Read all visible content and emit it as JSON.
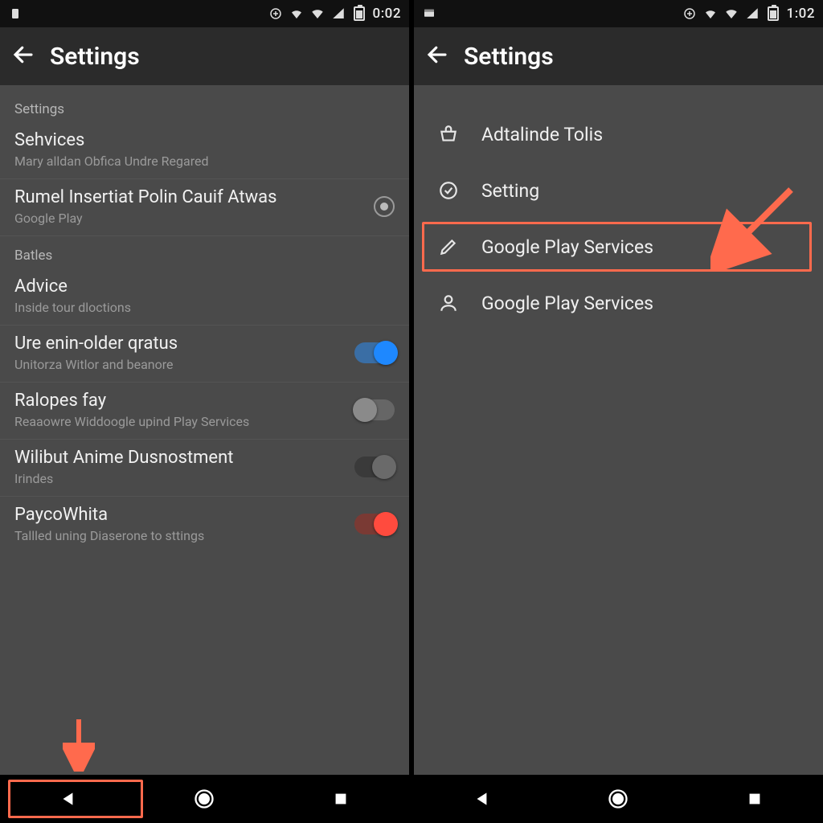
{
  "left": {
    "status": {
      "time": "0:02"
    },
    "appbar": {
      "title": "Settings"
    },
    "sections": {
      "s1_label": "Settings",
      "row1": {
        "title": "Sehvices",
        "sub": "Mary alldan Obfica Undre Regared"
      },
      "row2": {
        "title": "Rumel Insertiat Polin Cauif Atwas",
        "sub": "Google Play"
      },
      "s2_label": "Batles",
      "row3": {
        "title": "Advice",
        "sub": "Inside tour dloctions"
      },
      "row4": {
        "title": "Ure enin-older qratus",
        "sub": "Unitorza Witlor and beanore"
      },
      "row5": {
        "title": "Ralopes fay",
        "sub": "Reaaowre Widdoogle upind Play Services"
      },
      "row6": {
        "title": "Wilibut Anime Dusnostment",
        "sub": "Irindes"
      },
      "row7": {
        "title": "PaycoWhita",
        "sub": "Tallled uning Diaserone to sttings"
      }
    }
  },
  "right": {
    "status": {
      "time": "1:02"
    },
    "appbar": {
      "title": "Settings"
    },
    "menu": {
      "i1": "Adtalinde Tolis",
      "i2": "Setting",
      "i3": "Google Play Services",
      "i4": "Google Play Services"
    }
  },
  "colors": {
    "accent_highlight": "#ff6a4d",
    "toggle_on_blue": "#1e88ff",
    "toggle_on_red": "#ff4b3e"
  }
}
